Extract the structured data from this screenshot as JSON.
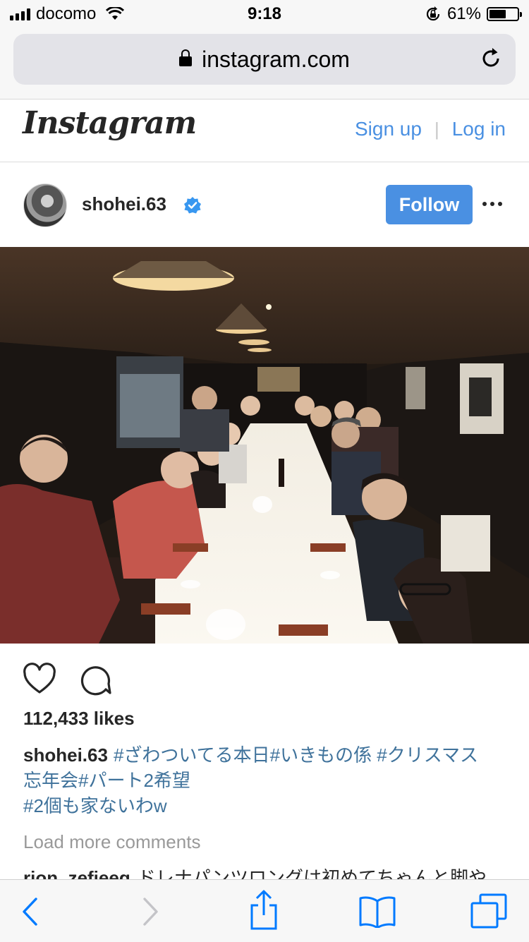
{
  "status_bar": {
    "carrier": "docomo",
    "time": "9:18",
    "battery_percent": "61%",
    "battery_level": 0.61
  },
  "browser": {
    "url": "instagram.com"
  },
  "instagram": {
    "logo": "Instagram",
    "signup_label": "Sign up",
    "separator": "|",
    "login_label": "Log in"
  },
  "post": {
    "username": "shohei.63",
    "verified": true,
    "follow_label": "Follow",
    "likes": "112,433 likes",
    "caption_user": "shohei.63",
    "caption_line1": "#ざわついてる本日#いきもの係 #クリスマス",
    "caption_line2": "忘年会#パート2希望",
    "caption_line3": "#2個も家ないわw",
    "load_more": "Load more comments",
    "next_comment_user": "rion_zefieeg",
    "next_comment_text": "ドレナパンツロングは初めてちゃんと脚や"
  },
  "colors": {
    "accent": "#4a90e2",
    "hashtag": "#3f729b",
    "ios_blue": "#007aff"
  },
  "icons": [
    "signal-icon",
    "wifi-icon",
    "orientation-lock-icon",
    "battery-icon",
    "lock-icon",
    "reload-icon",
    "verified-badge-icon",
    "more-options-icon",
    "like-heart-icon",
    "comment-bubble-icon",
    "back-arrow-icon",
    "forward-arrow-icon",
    "share-icon",
    "bookmarks-icon",
    "tabs-icon"
  ]
}
